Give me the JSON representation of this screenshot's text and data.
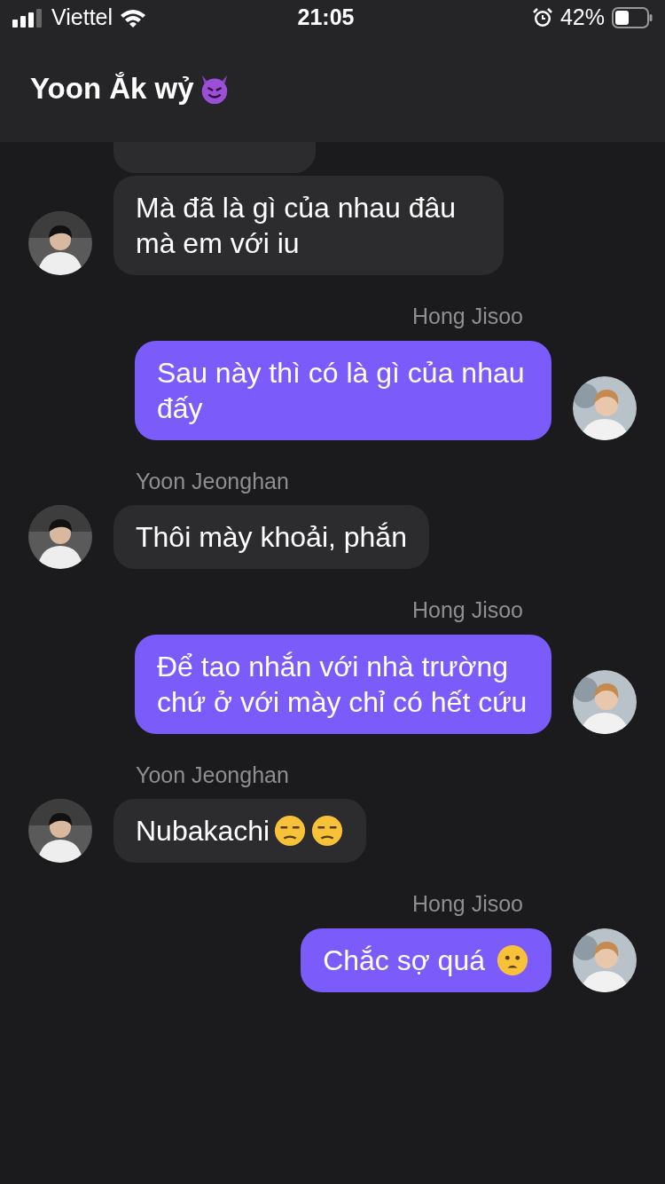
{
  "status_bar": {
    "carrier": "Viettel",
    "time": "21:05",
    "battery": "42%"
  },
  "header": {
    "title": "Yoon Ắk wỷ",
    "icons": [
      {
        "kind": "devil"
      }
    ]
  },
  "messages": [
    {
      "kind": "clipped"
    },
    {
      "kind": "incoming",
      "text": "Mà đã là gì của nhau đâu mà em với iu"
    },
    {
      "kind": "outgoing",
      "sender": "Hong Jisoo",
      "text": "Sau này thì có là gì của nhau đấy"
    },
    {
      "kind": "incoming",
      "sender": "Yoon Jeonghan",
      "text": "Thôi mày khoải, phắn"
    },
    {
      "kind": "outgoing",
      "sender": "Hong Jisoo",
      "text": "Để tao nhắn với nhà trường chứ ở với mày chỉ có hết cứu"
    },
    {
      "kind": "incoming",
      "sender": "Yoon Jeonghan",
      "text": "Nubakachi",
      "icons": [
        {
          "kind": "unamused"
        },
        {
          "kind": "unamused"
        }
      ]
    },
    {
      "kind": "outgoing",
      "sender": "Hong Jisoo",
      "text": "Chắc sợ quá",
      "icons": [
        {
          "kind": "worried"
        }
      ]
    }
  ]
}
